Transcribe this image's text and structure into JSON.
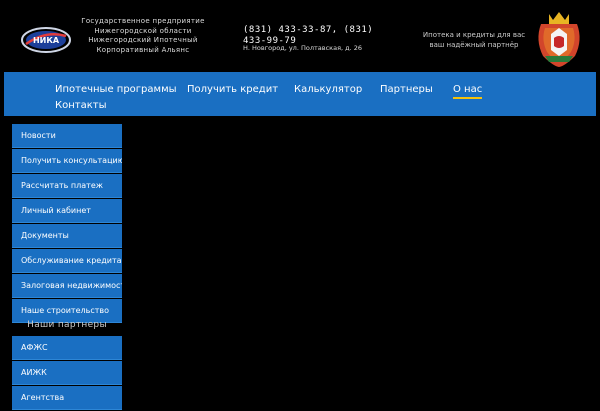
{
  "header": {
    "logo_lines": [
      "Государственное предприятие",
      "Нижегородской области",
      "Нижегородский Ипотечный",
      "Корпоративный Альянс"
    ],
    "phones_line1": "(831) 433-33-87, (831)",
    "phones_line2": "433-99-79",
    "address": "Н. Новгород, ул. Полтавская, д. 26",
    "slogan_line1": "Ипотека и кредиты для вас",
    "slogan_line2": "ваш надёжный партнёр"
  },
  "nav": {
    "items": [
      {
        "label": "Ипотечные программы"
      },
      {
        "label": "Получить кредит"
      },
      {
        "label": "Калькулятор"
      },
      {
        "label": "Партнеры"
      },
      {
        "label": "О нас"
      },
      {
        "label": "Контакты"
      }
    ],
    "active": "О нас"
  },
  "sidebar": {
    "items": [
      {
        "label": "Новости"
      },
      {
        "label": "Получить консультацию"
      },
      {
        "label": "Рассчитать платеж"
      },
      {
        "label": "Личный кабинет"
      },
      {
        "label": "Документы"
      },
      {
        "label": "Обслуживание кредита"
      },
      {
        "label": "Залоговая недвижимость"
      },
      {
        "label": "Наше строительство"
      }
    ],
    "partners_heading": "Наши партнеры",
    "partners": [
      {
        "label": "АФЖС"
      },
      {
        "label": "АИЖК"
      },
      {
        "label": "Агентства"
      }
    ]
  },
  "colors": {
    "nav_bg": "#1a6fc2",
    "active_underline": "#f4c20d",
    "page_bg": "#000000"
  }
}
